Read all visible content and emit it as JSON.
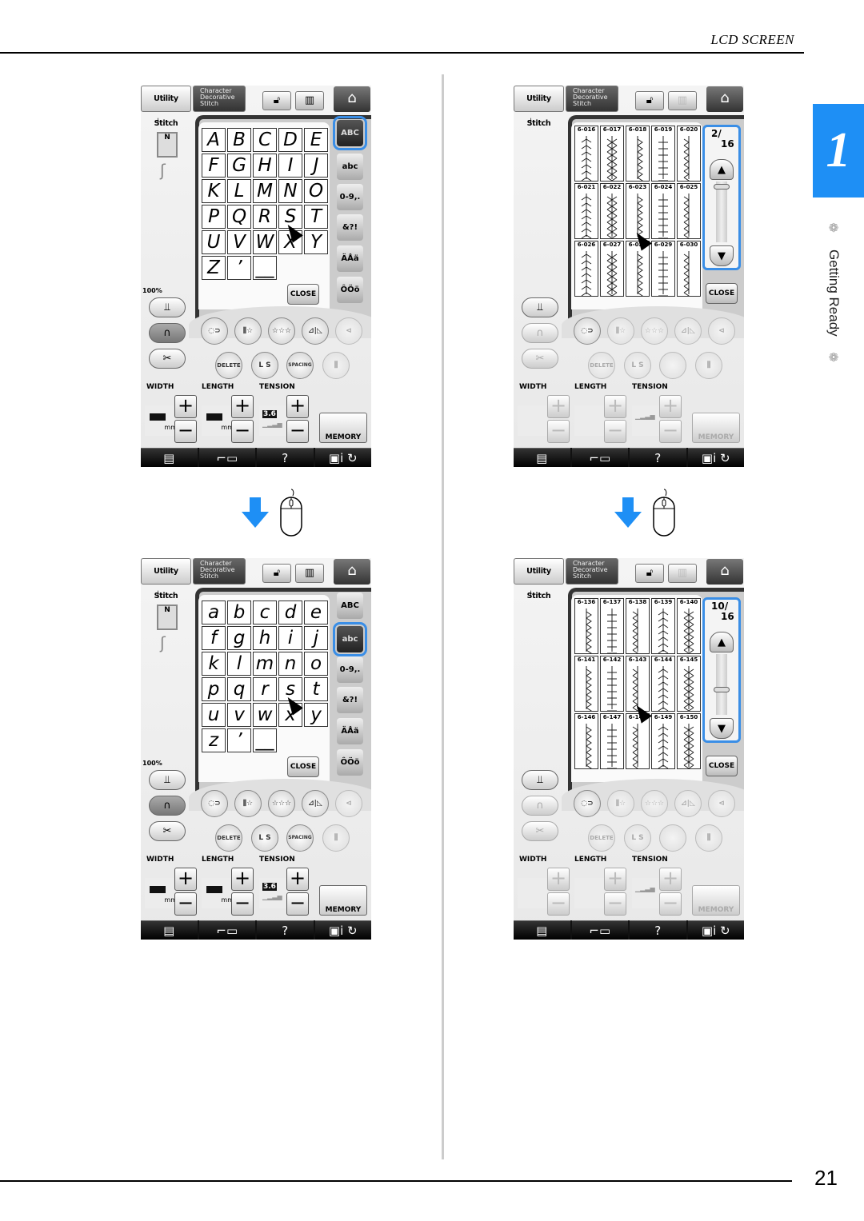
{
  "header": {
    "title": "LCD SCREEN"
  },
  "footer": {
    "page_number": "21"
  },
  "chapter": {
    "number": "1",
    "label": "Getting Ready",
    "color": "#1e8ff5"
  },
  "accent_color": "#3a8ee6",
  "screens": [
    {
      "type": "character",
      "selected_tab": 0,
      "chars": [
        "A",
        "B",
        "C",
        "D",
        "E",
        "F",
        "G",
        "H",
        "I",
        "J",
        "K",
        "L",
        "M",
        "N",
        "O",
        "P",
        "Q",
        "R",
        "S",
        "T",
        "U",
        "V",
        "W",
        "X",
        "Y",
        "Z",
        "’",
        "__"
      ]
    },
    {
      "type": "stitch",
      "page": "2",
      "total": "16",
      "thumb": 0.05,
      "stitches": [
        "6-016",
        "6-017",
        "6-018",
        "6-019",
        "6-020",
        "6-021",
        "6-022",
        "6-023",
        "6-024",
        "6-025",
        "6-026",
        "6-027",
        "6-028",
        "6-029",
        "6-030"
      ]
    },
    {
      "type": "character",
      "selected_tab": 1,
      "chars": [
        "a",
        "b",
        "c",
        "d",
        "e",
        "f",
        "g",
        "h",
        "i",
        "j",
        "k",
        "l",
        "m",
        "n",
        "o",
        "p",
        "q",
        "r",
        "s",
        "t",
        "u",
        "v",
        "w",
        "x",
        "y",
        "z",
        "’",
        "__"
      ]
    },
    {
      "type": "stitch",
      "page": "10",
      "total": "16",
      "thumb": 0.6,
      "stitches": [
        "6-136",
        "6-137",
        "6-138",
        "6-139",
        "6-140",
        "6-141",
        "6-142",
        "6-143",
        "6-144",
        "6-145",
        "6-146",
        "6-147",
        "6-148",
        "6-149",
        "6-150"
      ]
    }
  ],
  "ui": {
    "utility_tab": "Utility Stitch",
    "character_tab": [
      "Character",
      "Decorative",
      "Stitch"
    ],
    "char_tabs": [
      "ABC",
      "abc",
      "0-9,.",
      "&?!",
      "ÄÅä",
      "ÔÖö"
    ],
    "close": "CLOSE",
    "zoom": "100%",
    "delete": "DELETE",
    "ls": "L  S",
    "spacing": "SPACING",
    "width": "WIDTH",
    "length": "LENGTH",
    "tension": "TENSION",
    "mm": "mm",
    "tension_value": "3.6",
    "memory": "MEMORY",
    "plus": "+",
    "minus": "−",
    "help": "?"
  }
}
